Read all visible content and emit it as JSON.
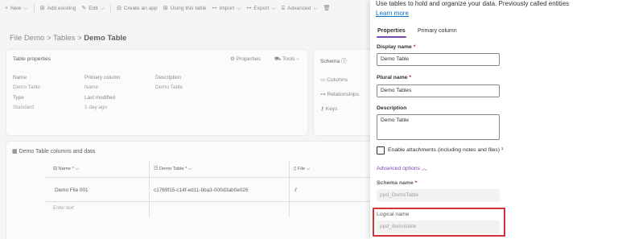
{
  "command_bar": {
    "new": "New",
    "add_existing": "Add existing",
    "edit": "Edit",
    "create_app": "Create an app",
    "using_table": "Using this table",
    "import": "Import",
    "export": "Export",
    "advanced": "Advanced"
  },
  "breadcrumb": {
    "part1": "File Demo",
    "sep": ">",
    "part2": "Tables",
    "current": "Demo Table"
  },
  "table_properties": {
    "title": "Table properties",
    "properties_btn": "Properties",
    "tools_btn": "Tools",
    "name_label": "Name",
    "name_value": "Demo Table",
    "primary_label": "Primary column",
    "primary_value": "Name",
    "desc_label": "Description",
    "desc_value": "Demo Table",
    "type_label": "Type",
    "type_value": "Standard",
    "modified_label": "Last modified",
    "modified_value": "1 day ago"
  },
  "schema": {
    "title": "Schema",
    "items": [
      "Columns",
      "Relationships",
      "Keys"
    ]
  },
  "data_grid": {
    "title": "Demo Table columns and data",
    "col1": "Name *",
    "col2": "Demo Table *",
    "col3": "File",
    "row1_col1": "Demo File 001",
    "row1_col2": "c1769f15-c14f-ed11-bba3-000d3ab0e026",
    "new_row_placeholder": "Enter text"
  },
  "panel": {
    "description": "Use tables to hold and organize your data. Previously called entities",
    "learn_more": "Learn more",
    "tab_properties": "Properties",
    "tab_primary": "Primary column",
    "display_name_label": "Display name",
    "display_name_value": "Demo Table",
    "plural_label": "Plural name",
    "plural_value": "Demo Tables",
    "description_label": "Description",
    "description_value": "Demo Table",
    "attachments_label": "Enable attachments (including notes and files)",
    "attachments_mark": "¹",
    "advanced_options": "Advanced options",
    "schema_name_label": "Schema name",
    "schema_name_value": "ppd_DemoTable",
    "logical_name_label": "Logical name",
    "logical_name_value": "ppd_demotable",
    "required_mark": "*"
  }
}
